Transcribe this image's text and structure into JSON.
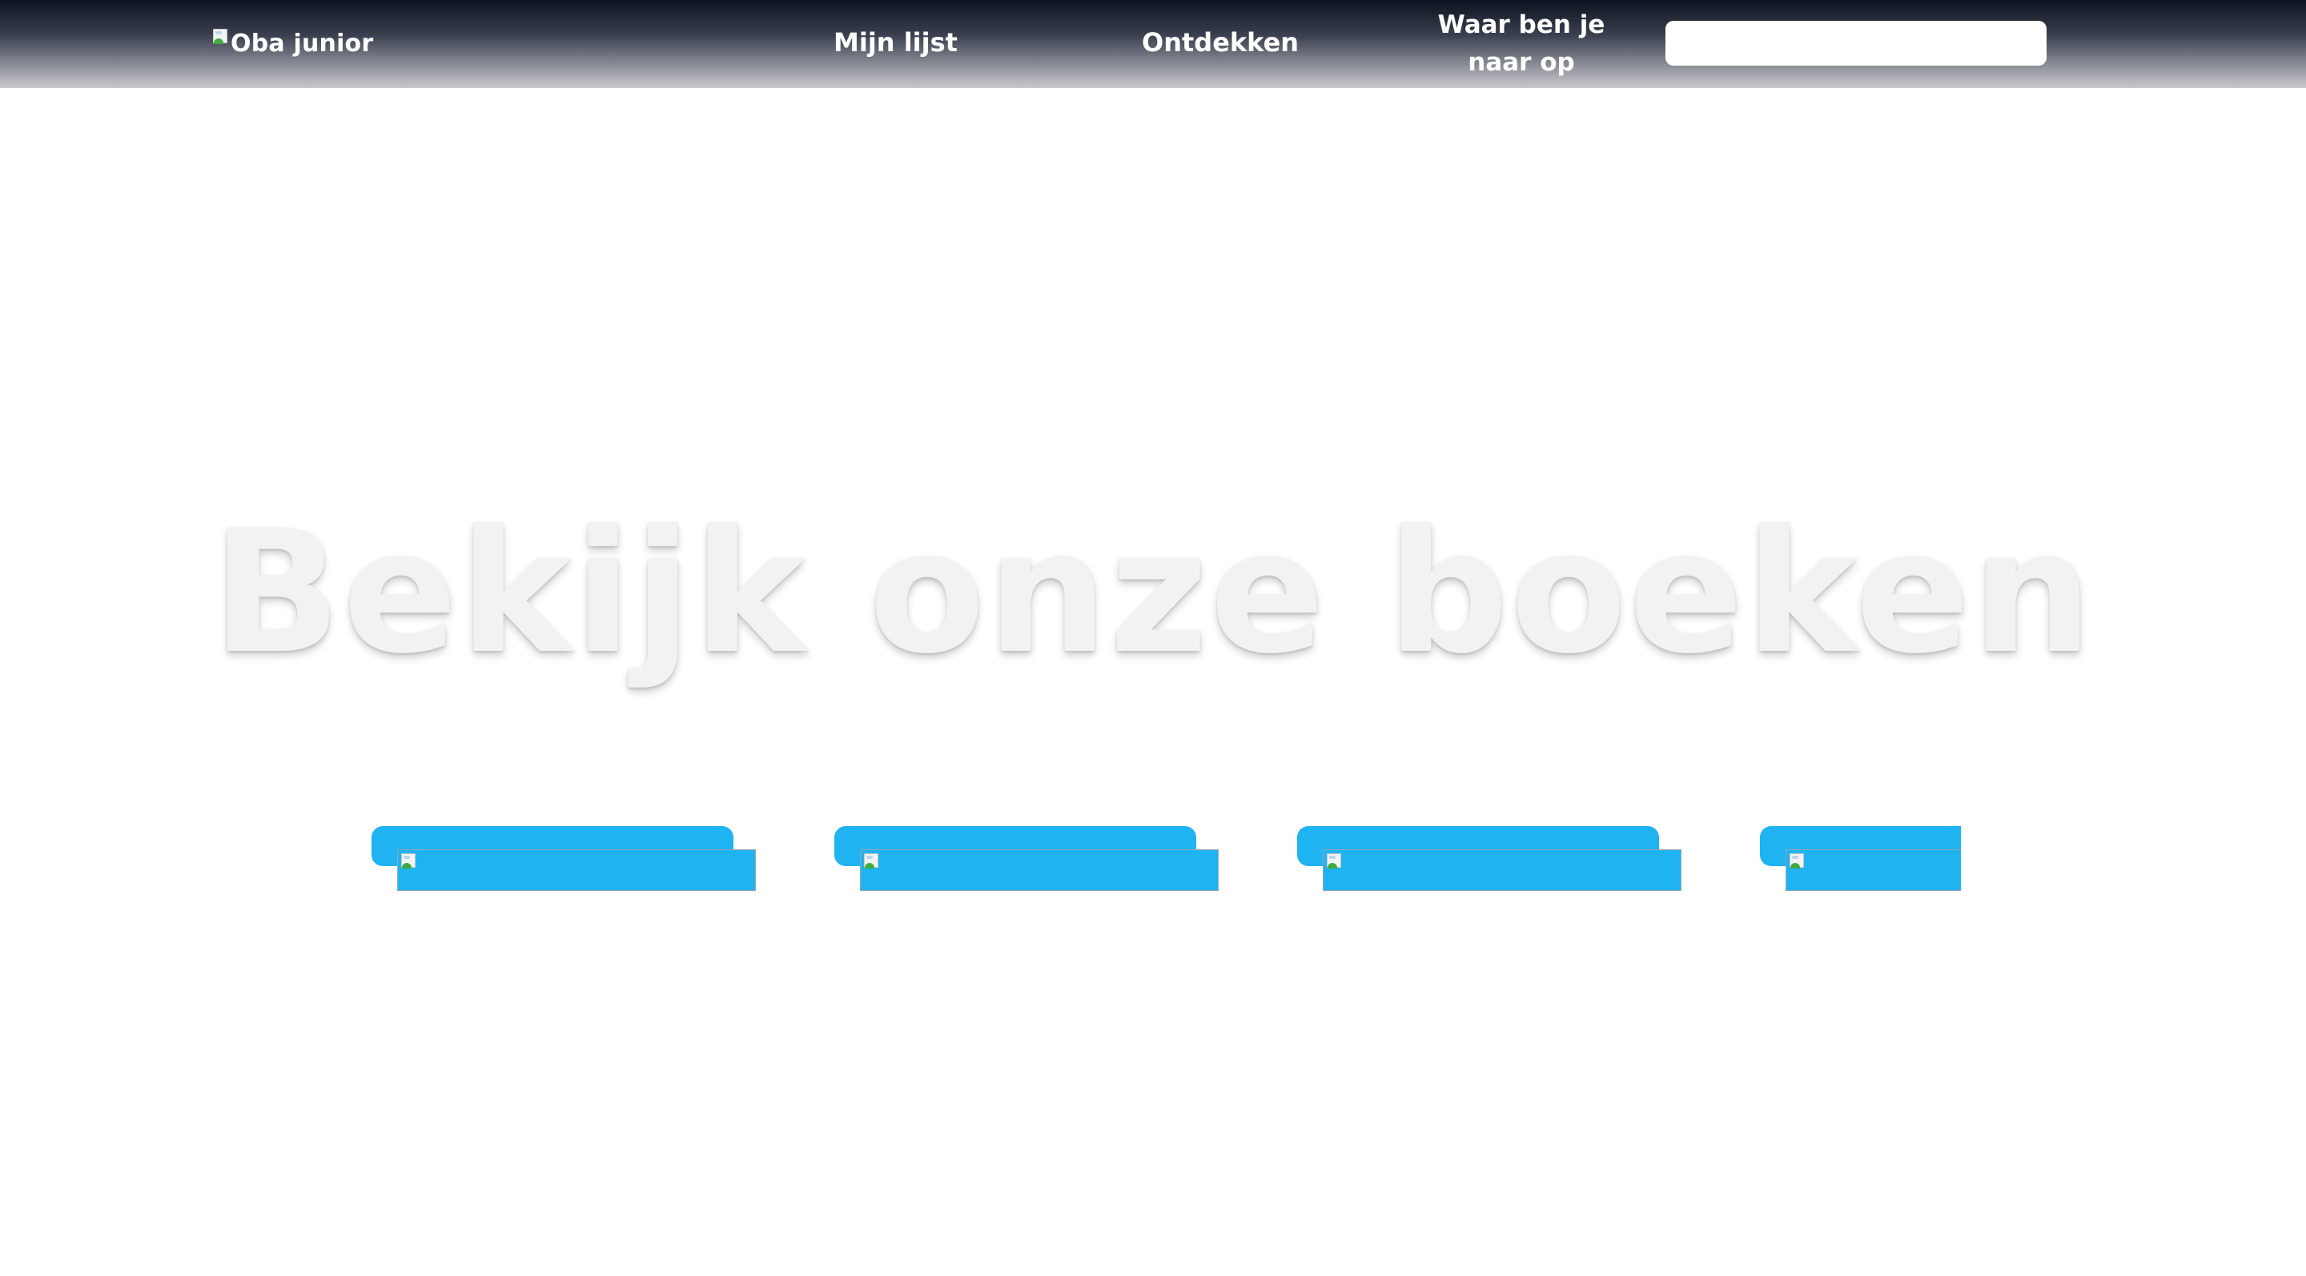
{
  "header": {
    "logo_alt": "Oba junior",
    "logo_icon": "broken-image-icon",
    "nav": [
      {
        "label": "Mijn lijst"
      },
      {
        "label": "Ontdekken"
      }
    ],
    "search": {
      "label": "Waar ben je naar op zoek?",
      "placeholder": "",
      "value": ""
    }
  },
  "hero": {
    "title": "Bekijk onze boeken"
  },
  "books": [
    {
      "cover_icon": "broken-image-icon"
    },
    {
      "cover_icon": "broken-image-icon"
    },
    {
      "cover_icon": "broken-image-icon"
    },
    {
      "cover_icon": "broken-image-icon"
    }
  ],
  "colors": {
    "header_top": "#0d1220",
    "header_bottom": "#c9cacd",
    "card_blue": "#1fb3f2",
    "title_color": "#f2f2f2",
    "background": "#ffffff"
  }
}
